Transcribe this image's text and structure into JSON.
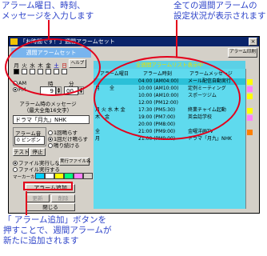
{
  "callouts": {
    "top_left": [
      "アラーム曜日、時刻、",
      "メッセージを入力します"
    ],
    "top_right": [
      "全ての週間アラームの",
      "設定状況が表示されます"
    ],
    "bottom_left": [
      "「 アラーム追加」ボタンを",
      "押すことで、週間アラームが",
      "新たに追加されます"
    ]
  },
  "window": {
    "title": "「お時間です！」週間アラームセット",
    "close_label": "×",
    "help_label": "ヘルプ",
    "print_button": "アラーム印刷"
  },
  "left": {
    "header": "週間アラームセット",
    "days": [
      "月",
      "火",
      "水",
      "木",
      "金",
      "土",
      "日"
    ],
    "ampm": [
      "AM",
      "PM"
    ],
    "ampm_selected": "PM",
    "hour_label": "時",
    "minute_label": "分",
    "hour_value": "9",
    "minute_value": "00",
    "message_label": [
      "アラーム時のメッセージ",
      "（最大全角16文字）"
    ],
    "message_value": "ドラマ「月九」NHK",
    "sound_label": "アラーム音",
    "sound_value": "0 ピンポン",
    "play_options": [
      "1回鳴らす",
      "1回だけ鳴らす",
      "鳴り続ける"
    ],
    "test_button": "テスト",
    "stop_button": "停止",
    "file_options": [
      "ファイル実行しない",
      "ファイル実行する"
    ],
    "exec_file_button": "実行ファイル名",
    "marker_label": "マーカーカラー",
    "marker_colors": [
      "#00d0ff",
      "#ffffff",
      "#ffff00",
      "#00ff80",
      "#ff80ff",
      "#d4d0c8"
    ],
    "add_button": "アラーム追加",
    "update_button": "更新",
    "delete_button": "削除",
    "close_button": "閉じる"
  },
  "right": {
    "list_title": "全週間アラームリスト表示中",
    "columns": [
      "アラーム曜日",
      "アラーム時刻",
      "アラームメッセージ"
    ],
    "rows": [
      {
        "days": "",
        "time": "04:00 (AM04:00)",
        "message": "メール配信自動実行",
        "selected": true
      },
      {
        "days": "月　　全",
        "time": "10:00 (AM10:00)",
        "message": "定例ミーティング",
        "selected": false
      },
      {
        "days": "",
        "time": "10:00 (AM10:00)",
        "message": "スポーツジム",
        "selected": false
      },
      {
        "days": "",
        "time": "12:00 (PM12:00)",
        "message": "",
        "selected": false
      },
      {
        "days": "月 火 水 木 金",
        "time": "17:30 (PM5:30)",
        "message": "終業チャイム起動",
        "selected": false
      },
      {
        "days": "木　金",
        "time": "19:00 (PM7:00)",
        "message": "英会話学校",
        "selected": false
      },
      {
        "days": "",
        "time": "20:00 (PM8:00)",
        "message": "",
        "selected": false
      },
      {
        "days": "全",
        "time": "21:00 (PM9:00)",
        "message": "金曜洋画TV",
        "selected": false
      },
      {
        "days": "月",
        "time": "21:00 (PM9:00)",
        "message": "ドラマ「月九」NHK",
        "selected": false
      }
    ]
  }
}
